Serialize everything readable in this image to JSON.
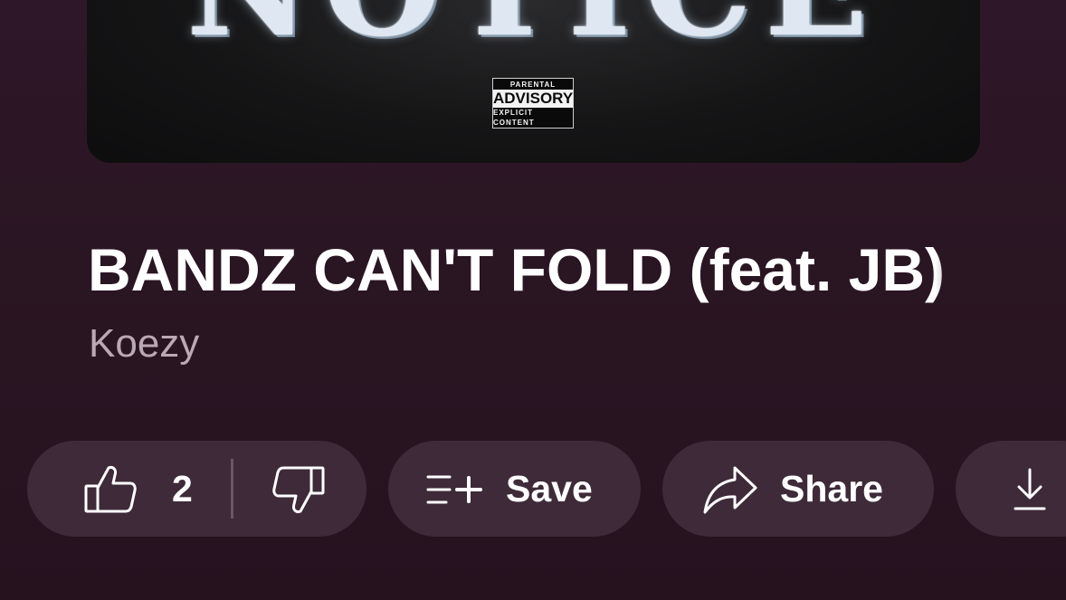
{
  "album_art": {
    "cover_text": "NOTICE",
    "advisory": {
      "line1": "PARENTAL",
      "line2": "ADVISORY",
      "line3": "EXPLICIT CONTENT"
    }
  },
  "track": {
    "title": "BANDZ CAN'T FOLD (feat. JB)",
    "artist": "Koezy"
  },
  "actions": {
    "like_count": "2",
    "save_label": "Save",
    "share_label": "Share"
  },
  "icons": {
    "like": "thumbs-up-icon",
    "dislike": "thumbs-down-icon",
    "save": "playlist-add-icon",
    "share": "share-arrow-icon",
    "download": "download-icon"
  },
  "colors": {
    "background": "#2a1523",
    "pill": "#3e2a38",
    "artist_text": "#bba8b5",
    "text": "#ffffff"
  }
}
